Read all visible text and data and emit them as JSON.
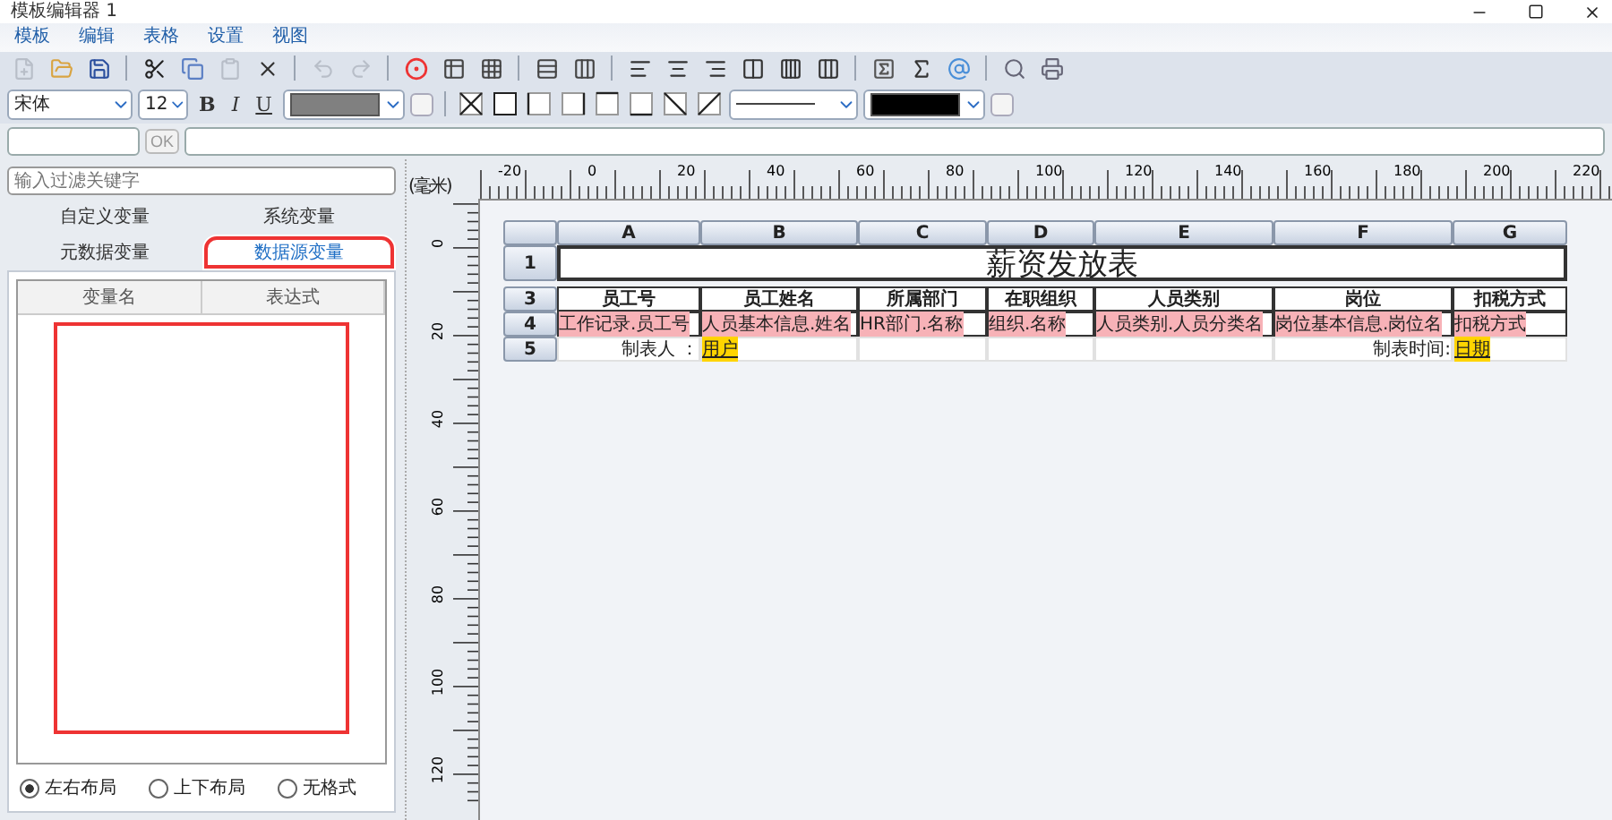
{
  "window": {
    "title": "模板编辑器 1"
  },
  "menu": [
    "模板",
    "编辑",
    "表格",
    "设置",
    "视图"
  ],
  "toolbar": [
    {
      "kind": "button",
      "disabled": true
    },
    {
      "kind": "button",
      "disabled": false
    },
    {
      "kind": "button",
      "disabled": false
    },
    {
      "kind": "separator"
    },
    {
      "kind": "button",
      "disabled": false
    },
    {
      "kind": "button",
      "disabled": false
    },
    {
      "kind": "button",
      "disabled": true
    },
    {
      "kind": "button",
      "disabled": false
    },
    {
      "kind": "separator"
    },
    {
      "kind": "button",
      "disabled": true
    },
    {
      "kind": "button",
      "disabled": true
    },
    {
      "kind": "separator"
    },
    {
      "kind": "button",
      "disabled": false
    },
    {
      "kind": "button",
      "disabled": false
    },
    {
      "kind": "button",
      "disabled": false
    },
    {
      "kind": "separator"
    },
    {
      "kind": "button",
      "disabled": false
    },
    {
      "kind": "button",
      "disabled": false
    },
    {
      "kind": "separator"
    },
    {
      "kind": "button",
      "disabled": false
    },
    {
      "kind": "button",
      "disabled": false
    },
    {
      "kind": "button",
      "disabled": false
    },
    {
      "kind": "button",
      "disabled": false
    },
    {
      "kind": "button",
      "disabled": false
    },
    {
      "kind": "button",
      "disabled": false
    },
    {
      "kind": "separator"
    },
    {
      "kind": "button",
      "disabled": false
    },
    {
      "kind": "button",
      "disabled": false
    },
    {
      "kind": "button",
      "disabled": false
    },
    {
      "kind": "separator"
    },
    {
      "kind": "button",
      "disabled": false
    },
    {
      "kind": "button",
      "disabled": false
    }
  ],
  "format_bar": {
    "font": "宋体",
    "size": "12",
    "style_buttons": [
      "B",
      "I",
      "U"
    ],
    "fill_checkbox": {
      "checked": false
    },
    "line_checkbox": {
      "checked": false
    }
  },
  "formula_bar": {
    "ok_button": "OK"
  },
  "left_panel": {
    "filter": {
      "placeholder": "输入过滤关键字"
    },
    "tab_rows": [
      [
        {
          "label": "自定义变量",
          "selected": false,
          "highlighted": false
        },
        {
          "label": "系统变量",
          "selected": false,
          "highlighted": false
        }
      ],
      [
        {
          "label": "元数据变量",
          "selected": false,
          "highlighted": false
        },
        {
          "label": "数据源变量",
          "selected": true,
          "highlighted": true
        }
      ]
    ],
    "table": {
      "columns": [
        "变量名",
        "表达式"
      ],
      "highlighted": true
    },
    "layout_options": [
      {
        "label": "左右布局",
        "selected": true
      },
      {
        "label": "上下布局",
        "selected": false
      },
      {
        "label": "无格式",
        "selected": false
      }
    ]
  },
  "ruler": {
    "unit": "(毫米)",
    "x_labels": [
      "-20",
      "0",
      "20",
      "40",
      "60",
      "80",
      "100",
      "120",
      "140",
      "160",
      "180",
      "200",
      "220"
    ],
    "y_labels": [
      "0",
      "20",
      "40",
      "60",
      "80",
      "100",
      "120"
    ]
  },
  "sheet": {
    "columns": [
      "A",
      "B",
      "C",
      "D",
      "E",
      "F",
      "G"
    ],
    "rows": [
      {
        "kind": "title",
        "label": "1",
        "cells": [
          {
            "kind": "title",
            "text": "薪资发放表"
          }
        ]
      },
      {
        "kind": "collapsed"
      },
      {
        "kind": "normal",
        "label": "3",
        "cells": [
          {
            "kind": "header",
            "text": "员工号"
          },
          {
            "kind": "header",
            "text": "员工姓名"
          },
          {
            "kind": "header",
            "text": "所属部门"
          },
          {
            "kind": "header",
            "text": "在职组织"
          },
          {
            "kind": "header",
            "text": "人员类别"
          },
          {
            "kind": "header",
            "text": "岗位"
          },
          {
            "kind": "header",
            "text": "扣税方式"
          }
        ]
      },
      {
        "kind": "normal",
        "label": "4",
        "cells": [
          {
            "kind": "field",
            "text": "工作记录.员工号"
          },
          {
            "kind": "field",
            "text": "人员基本信息.姓名"
          },
          {
            "kind": "field",
            "text": "HR部门.名称"
          },
          {
            "kind": "field",
            "text": "组织.名称"
          },
          {
            "kind": "field",
            "text": "人员类别.人员分类名"
          },
          {
            "kind": "field",
            "text": "岗位基本信息.岗位名"
          },
          {
            "kind": "field",
            "text": "扣税方式"
          }
        ]
      },
      {
        "kind": "normal",
        "label": "5",
        "cells": [
          {
            "kind": "label",
            "text": "制表人 ："
          },
          {
            "kind": "param",
            "text": "用户"
          },
          {
            "kind": "empty"
          },
          {
            "kind": "empty"
          },
          {
            "kind": "empty"
          },
          {
            "kind": "label",
            "text": "制表时间:"
          },
          {
            "kind": "param",
            "text": "日期"
          }
        ]
      }
    ]
  }
}
